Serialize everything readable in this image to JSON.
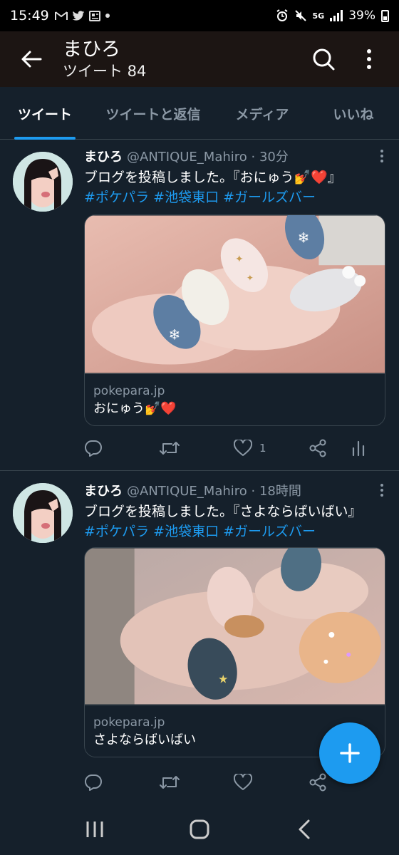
{
  "status_bar": {
    "time": "15:49",
    "left_icons": [
      "gmail-icon",
      "twitter-icon",
      "news-icon",
      "dot"
    ],
    "network": "5G",
    "battery": "39%"
  },
  "header": {
    "title": "まひろ",
    "subtitle": "ツイート 84"
  },
  "tabs": [
    {
      "label": "ツイート",
      "active": true
    },
    {
      "label": "ツイートと返信",
      "active": false
    },
    {
      "label": "メディア",
      "active": false
    },
    {
      "label": "いいね",
      "active": false
    }
  ],
  "tweets": [
    {
      "name": "まひろ",
      "handle": "@ANTIQUE_Mahiro",
      "time": "· 30分",
      "text": "ブログを投稿しました。『おにゅう💅❤️』",
      "hashtags": [
        "#ポケパラ",
        "#池袋東口",
        "#ガールズバー"
      ],
      "card_domain": "pokepara.jp",
      "card_title": "おにゅう💅❤️",
      "like_count": "1"
    },
    {
      "name": "まひろ",
      "handle": "@ANTIQUE_Mahiro",
      "time": "· 18時間",
      "text": "ブログを投稿しました。『さよならばいばい』",
      "hashtags": [
        "#ポケパラ",
        "#池袋東口",
        "#ガールズバー"
      ],
      "card_domain": "pokepara.jp",
      "card_title": "さよならばいばい",
      "like_count": ""
    }
  ],
  "colors": {
    "background": "#15202b",
    "header": "#1c1513",
    "accent": "#1d9bf0",
    "muted": "#8b98a5",
    "divider": "#38444d"
  }
}
